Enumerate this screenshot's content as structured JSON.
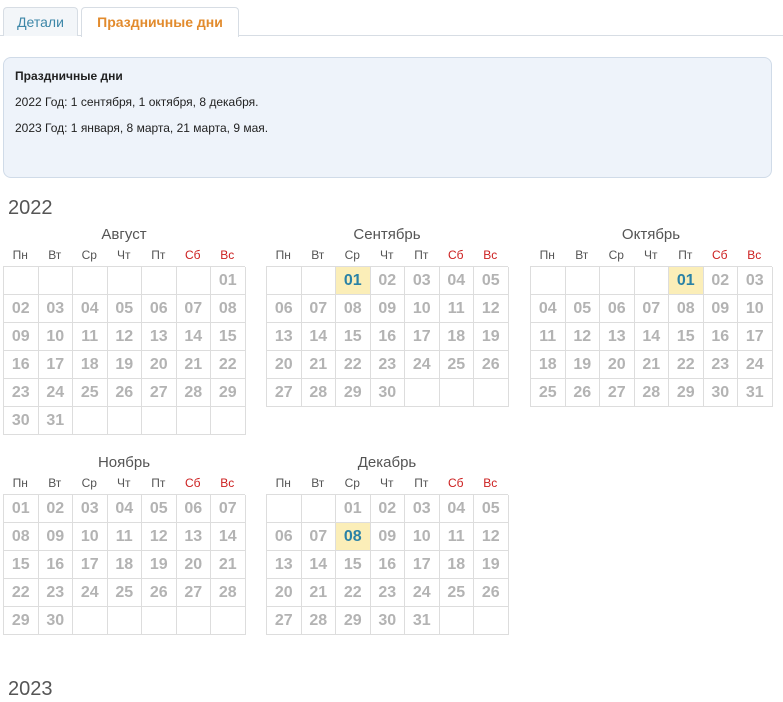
{
  "tabs": [
    {
      "label": "Детали"
    },
    {
      "label": "Праздничные дни"
    }
  ],
  "info": {
    "title": "Праздничные дни",
    "lines": [
      "2022 Год: 1 сентября, 1 октября, 8 декабря.",
      "2023 Год: 1 января, 8 марта, 21 марта, 9 мая."
    ]
  },
  "weekdays": [
    "Пн",
    "Вт",
    "Ср",
    "Чт",
    "Пт",
    "Сб",
    "Вс"
  ],
  "colors": {
    "weekend": "#cc1f1f",
    "holiday_bg": "#fbeeb8",
    "holiday_text": "#2a82a6",
    "tab_active": "#e28b2d",
    "tab_inactive": "#3d87a8"
  },
  "years": [
    {
      "label": "2022",
      "months": [
        {
          "name": "Август",
          "offset": 7,
          "days": 31,
          "holidays": []
        },
        {
          "name": "Сентябрь",
          "offset": 3,
          "days": 30,
          "holidays": [
            1
          ]
        },
        {
          "name": "Октябрь",
          "offset": 5,
          "days": 31,
          "holidays": [
            1
          ]
        },
        {
          "name": "Ноябрь",
          "offset": 1,
          "days": 30,
          "holidays": []
        },
        {
          "name": "Декабрь",
          "offset": 3,
          "days": 31,
          "holidays": [
            8
          ]
        }
      ]
    },
    {
      "label": "2023",
      "months": []
    }
  ]
}
